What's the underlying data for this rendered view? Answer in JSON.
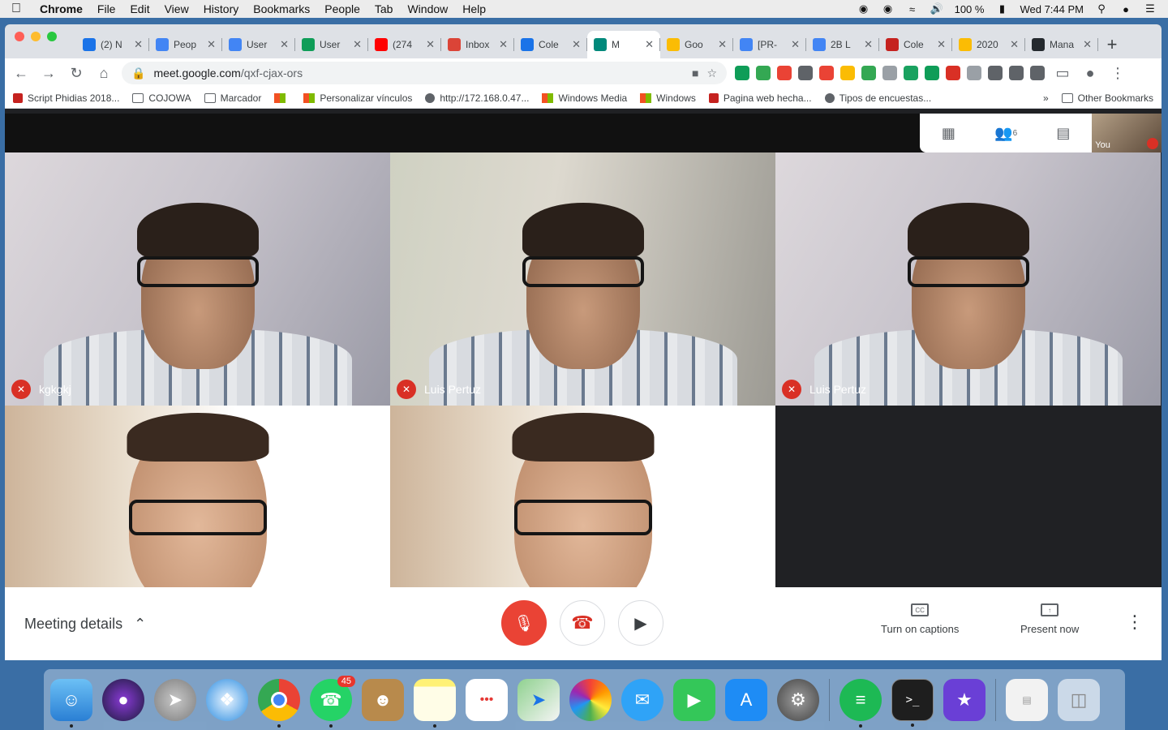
{
  "menubar": {
    "app": "Chrome",
    "items": [
      "File",
      "Edit",
      "View",
      "History",
      "Bookmarks",
      "People",
      "Tab",
      "Window",
      "Help"
    ],
    "battery": "100 %",
    "clock": "Wed 7:44 PM"
  },
  "tabs": [
    {
      "label": "(2) N",
      "color": "#1a73e8"
    },
    {
      "label": "Peop",
      "color": "#4285f4"
    },
    {
      "label": "User",
      "color": "#4285f4"
    },
    {
      "label": "User",
      "color": "#0f9d58"
    },
    {
      "label": "(274",
      "color": "#ff0000"
    },
    {
      "label": "Inbox",
      "color": "#db4437"
    },
    {
      "label": "Cole",
      "color": "#1a73e8"
    },
    {
      "label": "M",
      "color": "#00897b",
      "active": true
    },
    {
      "label": "Goo",
      "color": "#fbbc04"
    },
    {
      "label": "[PR-",
      "color": "#4285f4"
    },
    {
      "label": "2B L",
      "color": "#4285f4"
    },
    {
      "label": "Cole",
      "color": "#c5221f"
    },
    {
      "label": "2020",
      "color": "#fbbc04"
    },
    {
      "label": "Mana",
      "color": "#24292e"
    }
  ],
  "url": {
    "host": "meet.google.com",
    "path": "/qxf-cjax-ors"
  },
  "extensions": [
    "#0f9d58",
    "#34a853",
    "#ea4335",
    "#5f6368",
    "#ea4335",
    "#fbbc04",
    "#34a853",
    "#9aa0a6",
    "#1aa260",
    "#0f9d58",
    "#d93025",
    "#9aa0a6",
    "#5f6368",
    "#5f6368",
    "#5f6368"
  ],
  "bookmarks": [
    {
      "label": "Script Phidias 2018...",
      "type": "app"
    },
    {
      "label": "COJOWA",
      "type": "folder"
    },
    {
      "label": "Marcador",
      "type": "folder"
    },
    {
      "label": "",
      "type": "ms"
    },
    {
      "label": "Personalizar vínculos",
      "type": "ms"
    },
    {
      "label": "http://172.168.0.47...",
      "type": "globe"
    },
    {
      "label": "Windows Media",
      "type": "ms"
    },
    {
      "label": "Windows",
      "type": "ms"
    },
    {
      "label": "Pagina web hecha...",
      "type": "app"
    },
    {
      "label": "Tipos de encuestas...",
      "type": "globe"
    }
  ],
  "overflow": "»",
  "other_bookmarks": "Other Bookmarks",
  "meet": {
    "participant_count": "6",
    "self_label": "You",
    "tiles": [
      {
        "name": "kgkgkj",
        "muted": true
      },
      {
        "name": "Luis Pertuz",
        "muted": true
      },
      {
        "name": "Luis Pertuz",
        "muted": true
      },
      {
        "name": "",
        "muted": false
      },
      {
        "name": "",
        "muted": false
      },
      {
        "name": "",
        "muted": false
      }
    ],
    "meeting_details": "Meeting details",
    "captions_label": "Turn on captions",
    "present_label": "Present now"
  },
  "dock": {
    "whatsapp_badge": "45"
  }
}
